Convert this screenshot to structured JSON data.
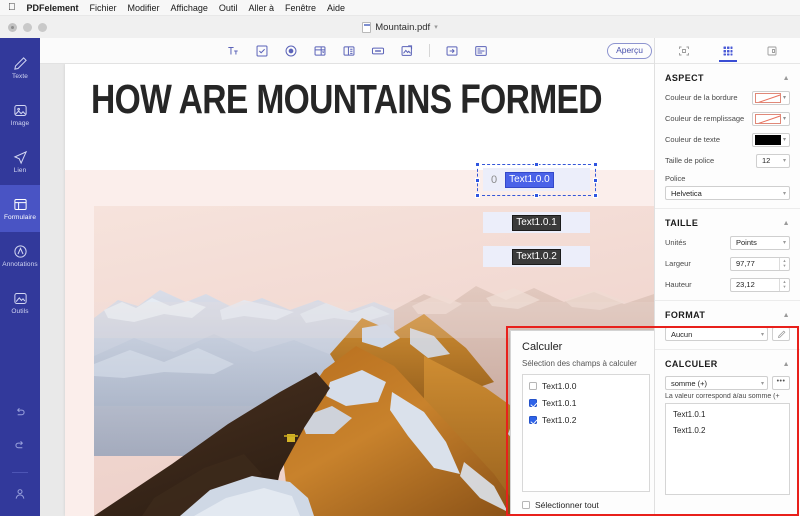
{
  "menubar": {
    "apple": "",
    "items": [
      {
        "label": "PDFelement",
        "brand": true
      },
      {
        "label": "Fichier"
      },
      {
        "label": "Modifier"
      },
      {
        "label": "Affichage"
      },
      {
        "label": "Outil"
      },
      {
        "label": "Aller à"
      },
      {
        "label": "Fenêtre"
      },
      {
        "label": "Aide"
      }
    ]
  },
  "titlebar": {
    "document": "Mountain.pdf"
  },
  "sidebar": {
    "items": [
      {
        "label": "Texte",
        "icon": "pencil-icon"
      },
      {
        "label": "Image",
        "icon": "image-icon"
      },
      {
        "label": "Lien",
        "icon": "link-send-icon"
      },
      {
        "label": "Formulaire",
        "icon": "form-icon",
        "active": true
      },
      {
        "label": "Annotations",
        "icon": "annotation-icon"
      },
      {
        "label": "Outils",
        "icon": "tools-icon"
      }
    ],
    "bottom": [
      {
        "icon": "undo-icon"
      },
      {
        "icon": "redo-icon"
      },
      {
        "icon": "user-icon"
      }
    ]
  },
  "toolbar": {
    "tools": [
      {
        "name": "text-field-tool",
        "glyph": "TI"
      },
      {
        "name": "checkbox-tool"
      },
      {
        "name": "radio-button-tool"
      },
      {
        "name": "combo-box-tool"
      },
      {
        "name": "list-box-tool"
      },
      {
        "name": "push-button-tool"
      },
      {
        "name": "image-field-tool"
      },
      {
        "name": "separator"
      },
      {
        "name": "tab-order-tool"
      },
      {
        "name": "form-alignment-tool"
      }
    ],
    "preview_label": "Aperçu"
  },
  "document": {
    "heading": "HOW ARE MOUNTAINS FORMED",
    "fields": [
      {
        "name": "Text1.0.0",
        "value": "0",
        "selected": true
      },
      {
        "name": "Text1.0.1",
        "value": "",
        "selected": false
      },
      {
        "name": "Text1.0.2",
        "value": "",
        "selected": false
      }
    ]
  },
  "calculate_dialog": {
    "title": "Calculer",
    "subtitle": "Sélection des champs à calculer",
    "options": [
      {
        "label": "Text1.0.0",
        "checked": false
      },
      {
        "label": "Text1.0.1",
        "checked": true
      },
      {
        "label": "Text1.0.2",
        "checked": true
      }
    ],
    "select_all_label": "Sélectionner tout",
    "select_all_checked": false
  },
  "properties": {
    "tabs": [
      {
        "name": "tab-page-properties",
        "active": false
      },
      {
        "name": "tab-field-properties",
        "active": true
      },
      {
        "name": "tab-appearance-properties",
        "active": false
      }
    ],
    "aspect": {
      "heading": "ASPECT",
      "border_color_label": "Couleur de la bordure",
      "border_color": "none",
      "fill_color_label": "Couleur de remplissage",
      "fill_color": "none",
      "text_color_label": "Couleur de texte",
      "text_color": "#000000",
      "font_size_label": "Taille de police",
      "font_size": "12",
      "font_label": "Police",
      "font": "Helvetica"
    },
    "size": {
      "heading": "TAILLE",
      "units_label": "Unités",
      "units": "Points",
      "width_label": "Largeur",
      "width": "97,77",
      "height_label": "Hauteur",
      "height": "23,12"
    },
    "format": {
      "heading": "FORMAT",
      "value": "Aucun"
    },
    "calculate": {
      "heading": "CALCULER",
      "operation": "somme (+)",
      "more_label": "•••",
      "note": "La valeur correspond à/au somme (+",
      "fields": [
        "Text1.0.1",
        "Text1.0.2"
      ]
    }
  },
  "colors": {
    "sidebar_blue": "#32399b",
    "sidebar_active": "#4954c4",
    "accent": "#3a4ed4",
    "highlight_red": "#e8201b",
    "field_fill": "#eceefa"
  }
}
